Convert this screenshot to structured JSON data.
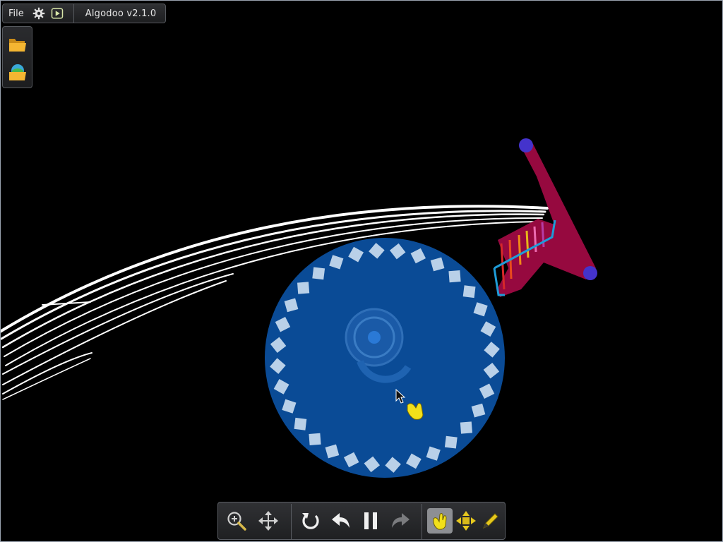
{
  "app": {
    "title": "Algodoo v2.1.0"
  },
  "menu": {
    "file_label": "File"
  },
  "icons": {
    "settings": "gear-icon",
    "play": "play-icon",
    "open_folder": "folder-icon",
    "open_scene": "scene-folder-icon",
    "zoom": "zoom-in-icon",
    "pan": "move-icon",
    "reset": "reset-icon",
    "undo": "undo-icon",
    "pause": "pause-icon",
    "redo": "redo-icon",
    "drag_tool": "hand-icon",
    "move_tool": "move-arrows-icon",
    "sketch_tool": "pencil-icon"
  },
  "toolbar": {
    "active_tool": "drag_tool"
  },
  "colors": {
    "background": "#000000",
    "wheel": "#0a4b96",
    "wheel_pads": "#b9d0e8",
    "arm": "#96093f",
    "hinge": "#4433cc",
    "trail": "#ffffff",
    "cursor_hand": "#f2e01a"
  }
}
